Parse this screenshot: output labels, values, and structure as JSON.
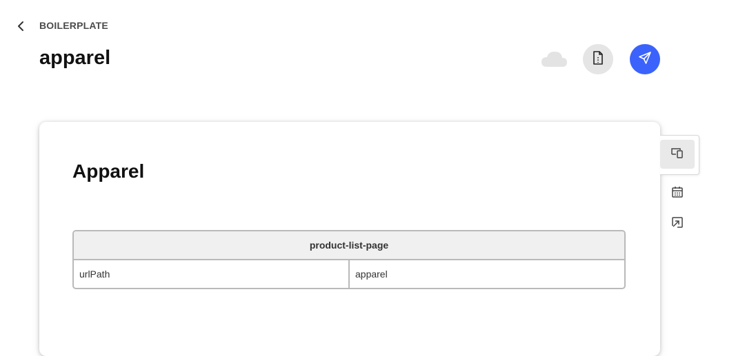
{
  "header": {
    "breadcrumb": "BOILERPLATE",
    "title": "apparel"
  },
  "toolbar": {
    "status_icon": "cloud-icon",
    "preview_icon": "document-icon",
    "publish_icon": "send-icon",
    "publish_color": "#3b63fb"
  },
  "document": {
    "heading": "Apparel",
    "block": {
      "name": "product-list-page",
      "rows": [
        [
          "urlPath",
          "apparel"
        ]
      ]
    }
  },
  "side_rail": {
    "items": [
      "preview-devices-icon",
      "calendar-icon",
      "open-in-icon"
    ]
  }
}
